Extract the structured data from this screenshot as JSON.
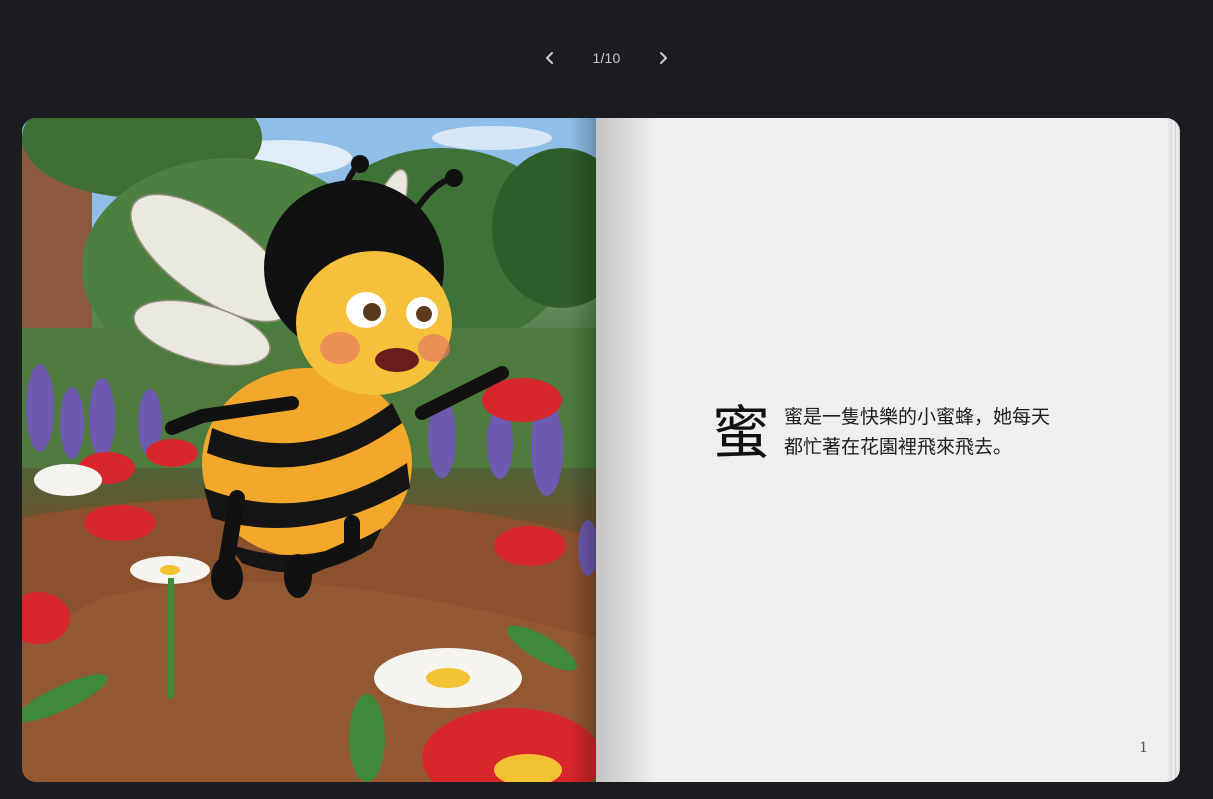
{
  "pager": {
    "prev_icon": "chevron-left-icon",
    "next_icon": "chevron-right-icon",
    "counter": "1/10"
  },
  "book": {
    "illustration": "bee-in-flower-garden",
    "dropcap": "蜜",
    "text": "蜜是一隻快樂的小蜜蜂，她每天都忙著在花園裡飛來飛去。",
    "page_number": "1"
  }
}
